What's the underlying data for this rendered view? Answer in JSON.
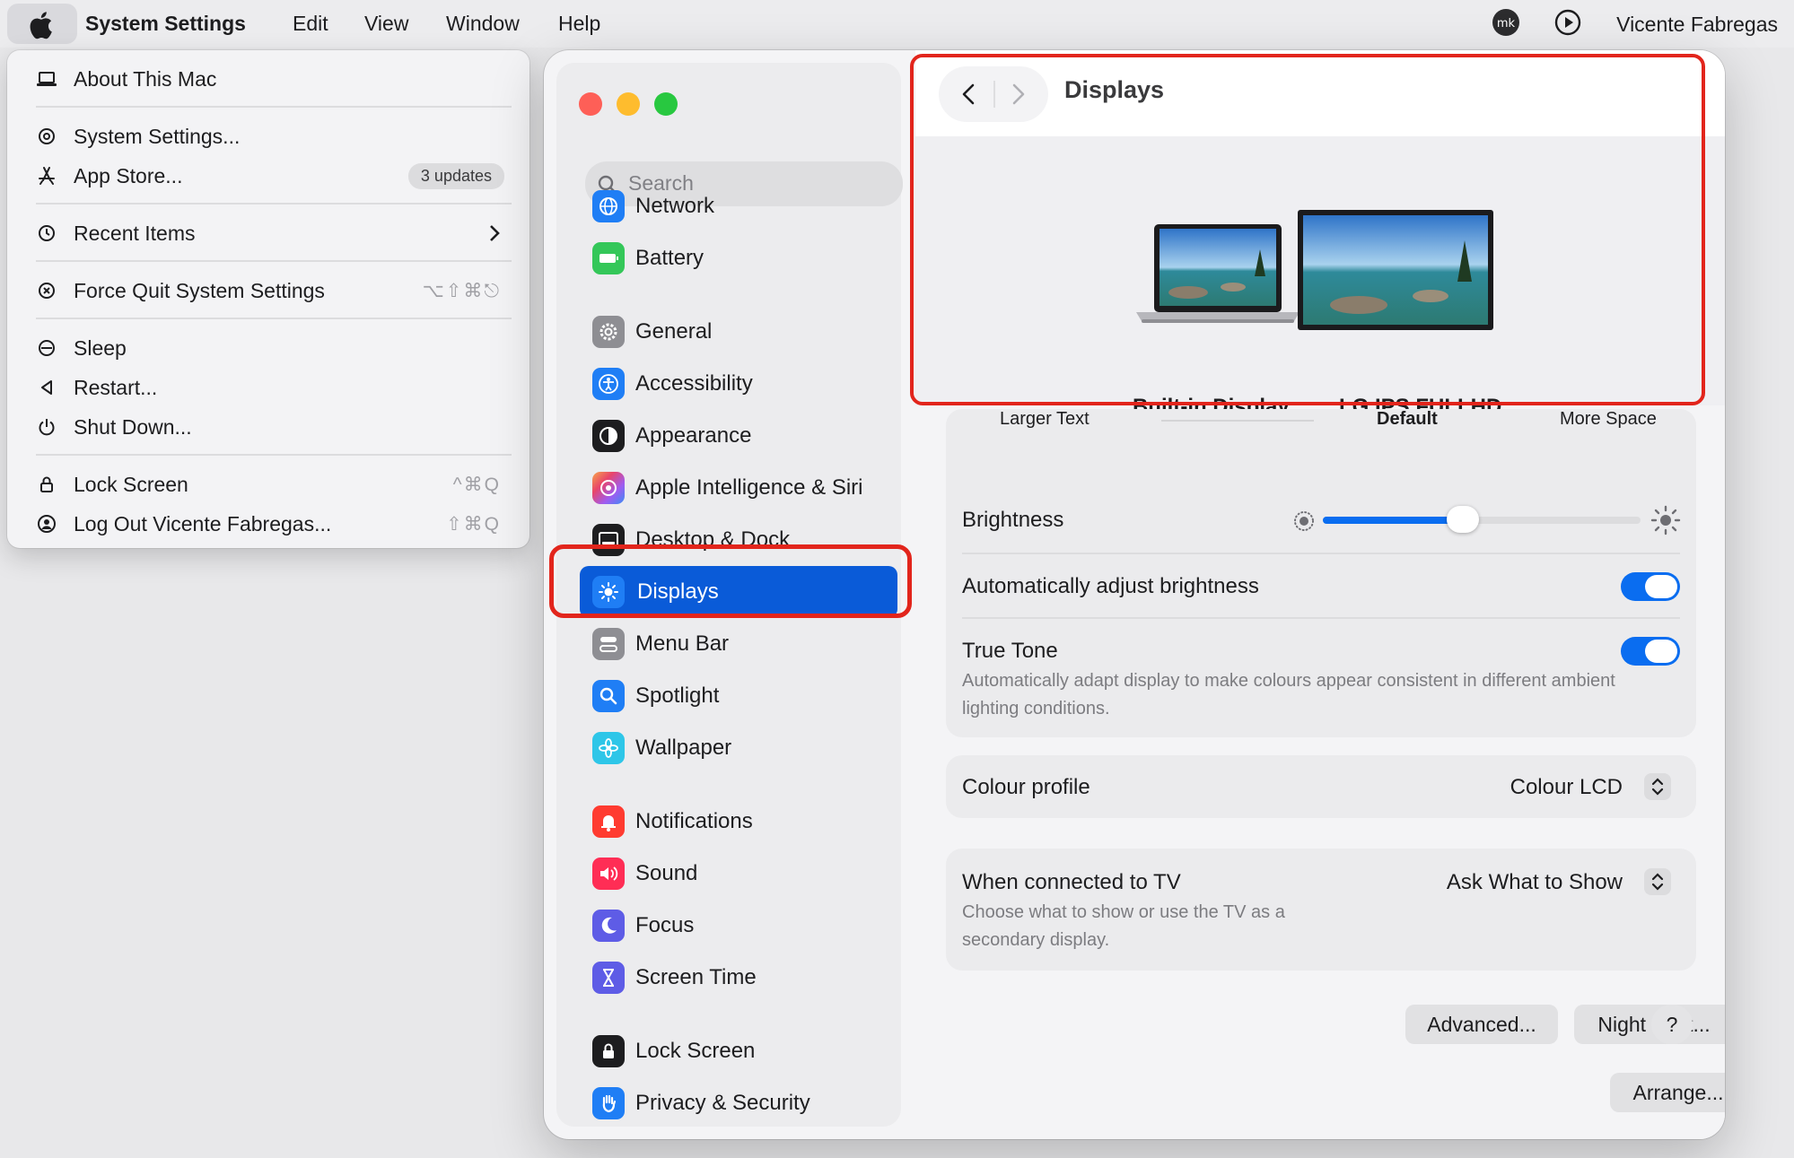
{
  "menubar": {
    "app_name": "System Settings",
    "items": [
      "Edit",
      "View",
      "Window",
      "Help"
    ],
    "user_name": "Vicente Fabregas",
    "status_icons": [
      "mk-icon",
      "play-circle-icon"
    ]
  },
  "apple_menu": {
    "about": "About This Mac",
    "system_settings": "System Settings...",
    "app_store": "App Store...",
    "app_store_badge": "3 updates",
    "recent_items": "Recent Items",
    "force_quit": "Force Quit System Settings",
    "force_quit_shortcut": "⌥⇧⌘⎋",
    "sleep": "Sleep",
    "restart": "Restart...",
    "shut_down": "Shut Down...",
    "lock_screen": "Lock Screen",
    "lock_screen_shortcut": "^⌘Q",
    "log_out": "Log Out Vicente Fabregas...",
    "log_out_shortcut": "⇧⌘Q"
  },
  "sidebar": {
    "search_placeholder": "Search",
    "items": {
      "network": "Network",
      "battery": "Battery",
      "general": "General",
      "accessibility": "Accessibility",
      "appearance": "Appearance",
      "apple_intelligence": "Apple Intelligence & Siri",
      "desktop_dock": "Desktop & Dock",
      "displays": "Displays",
      "menu_bar": "Menu Bar",
      "spotlight": "Spotlight",
      "wallpaper": "Wallpaper",
      "notifications": "Notifications",
      "sound": "Sound",
      "focus": "Focus",
      "screen_time": "Screen Time",
      "lock_screen": "Lock Screen",
      "privacy_security": "Privacy & Security"
    },
    "selected": "Displays"
  },
  "main": {
    "title": "Displays",
    "displays": [
      "Built-in Display",
      "LG IPS FULLHD"
    ],
    "resolution": {
      "larger_text": "Larger Text",
      "default": "Default",
      "more_space": "More Space"
    },
    "brightness_label": "Brightness",
    "brightness_value": 0.44,
    "auto_brightness_label": "Automatically adjust brightness",
    "auto_brightness_on": true,
    "true_tone_label": "True Tone",
    "true_tone_desc": "Automatically adapt display to make colours appear consistent in different ambient lighting conditions.",
    "true_tone_on": true,
    "colour_profile_label": "Colour profile",
    "colour_profile_value": "Colour LCD",
    "tv_label": "When connected to TV",
    "tv_desc": "Choose what to show or use the TV as a secondary display.",
    "tv_value": "Ask What to Show",
    "advanced_button": "Advanced...",
    "night_shift_button": "Night Shift...",
    "help_button": "?",
    "arrange_button": "Arrange..."
  },
  "colors": {
    "accent": "#0a5bd8",
    "highlight_outline": "#e2251c",
    "toggle_on": "#0a6df0"
  }
}
